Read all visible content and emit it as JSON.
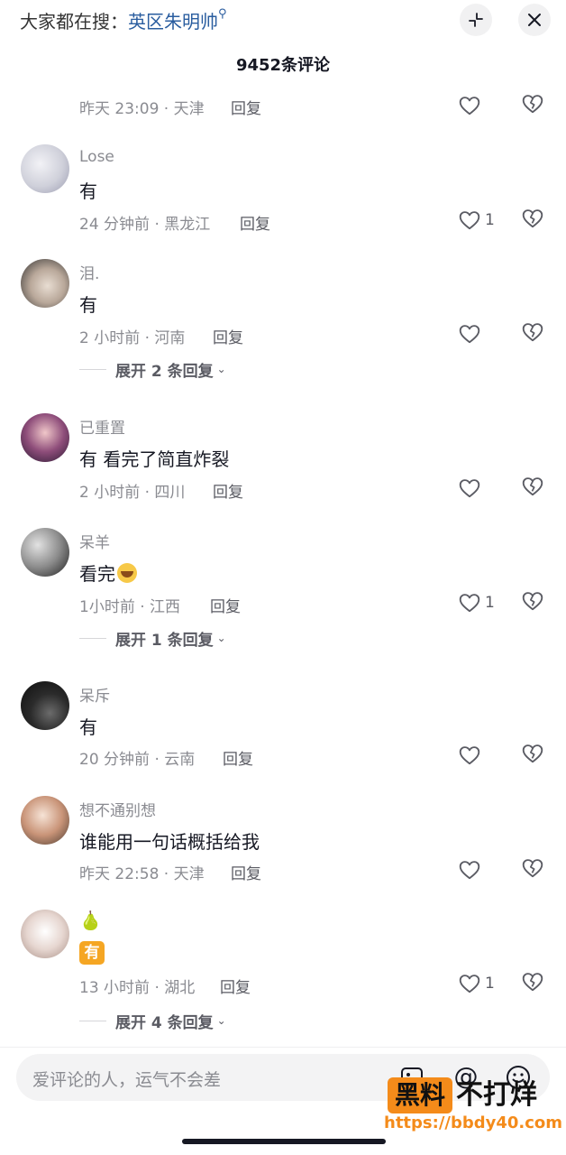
{
  "header": {
    "search_hint_prefix": "大家都在搜：",
    "search_hint_keyword": "英区朱明帅",
    "collapse_icon": "collapse-icon",
    "close_icon": "close-icon"
  },
  "comment_count_title": "9452条评论",
  "first_meta": {
    "meta": "昨天 23:09 · 天津",
    "reply": "回复"
  },
  "comments": [
    {
      "user": "Lose",
      "text": "有",
      "meta": "24 分钟前 · 黑龙江",
      "reply": "回复",
      "likes": "1"
    },
    {
      "user": "泪.",
      "text": "有",
      "meta": "2 小时前 · 河南",
      "reply": "回复",
      "likes": "",
      "expand": "展开 2 条回复"
    },
    {
      "user": "已重置",
      "text": "有 看完了简直炸裂",
      "meta": "2 小时前 · 四川",
      "reply": "回复",
      "likes": ""
    },
    {
      "user": "呆羊",
      "text": "看完",
      "meta": "1小时前 · 江西",
      "reply": "回复",
      "likes": "1",
      "expand": "展开 1 条回复"
    },
    {
      "user": "呆斥",
      "text": "有",
      "meta": "20 分钟前 · 云南",
      "reply": "回复",
      "likes": ""
    },
    {
      "user": "想不通别想",
      "text": "谁能用一句话概括给我",
      "meta": "昨天 22:58 · 天津",
      "reply": "回复",
      "likes": ""
    },
    {
      "user": "🍐",
      "text": "有",
      "meta": "13 小时前 · 湖北",
      "reply": "回复",
      "likes": "1",
      "expand": "展开 4 条回复"
    }
  ],
  "input": {
    "placeholder": "爱评论的人，运气不会差"
  },
  "watermark": {
    "box": "黑料",
    "text": "不打烊",
    "url": "https://bbdy40.com"
  },
  "colors": {
    "keyword": "#2a5d9f",
    "watermark_orange": "#f48b1a",
    "badge": "#f5a623"
  }
}
